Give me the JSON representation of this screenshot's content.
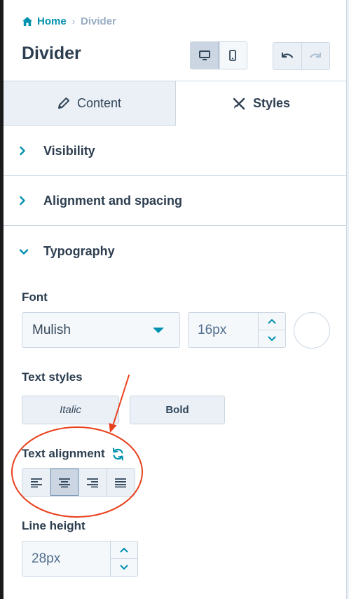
{
  "breadcrumb": {
    "home": "Home",
    "separator": "›",
    "current": "Divider"
  },
  "header": {
    "title": "Divider"
  },
  "tabs": [
    {
      "label": "Content",
      "icon": "pencil-icon",
      "active": false
    },
    {
      "label": "Styles",
      "icon": "brush-icon",
      "active": true
    }
  ],
  "sections": {
    "visibility": {
      "label": "Visibility",
      "expanded": false
    },
    "alignment": {
      "label": "Alignment and spacing",
      "expanded": false
    },
    "typography": {
      "label": "Typography",
      "expanded": true
    }
  },
  "font": {
    "label": "Font",
    "family": "Mulish",
    "size": "16px",
    "color": "#ffffff"
  },
  "text_styles": {
    "label": "Text styles",
    "italic": "Italic",
    "bold": "Bold"
  },
  "text_alignment": {
    "label": "Text alignment",
    "options": [
      "left",
      "center",
      "right",
      "justify"
    ],
    "selected": "center"
  },
  "line_height": {
    "label": "Line height",
    "value": "28px"
  },
  "colors": {
    "accent": "#0091ae",
    "text": "#33475b",
    "annotation": "#e8401c"
  }
}
